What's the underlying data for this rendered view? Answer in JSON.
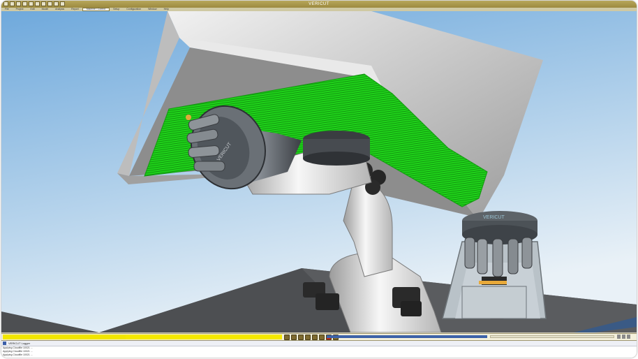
{
  "window": {
    "title": "VERICUT"
  },
  "menu": {
    "items": [
      "File",
      "Project",
      "Edit",
      "Model",
      "Analysis",
      "Report",
      "Machine / Control",
      "Setup",
      "Configuration",
      "Window",
      "Help"
    ],
    "active_index": 6
  },
  "toolbar": {
    "progress_fraction": 0.44
  },
  "logger": {
    "title": "VERICUT Logger",
    "rows": [
      "Applying Cloudfile 10021 ...",
      "Applying Cloudfile 10021 ...",
      "Applying Cloudfile 10021 ..."
    ]
  },
  "scene": {
    "colors": {
      "sky_top": "#6fa9dc",
      "sky_bottom": "#e9f1f7",
      "floor": "#4d4f52",
      "part_shell": "#d3d3d3",
      "toolpath": "#1fd21a",
      "robot": "#e6e6e6",
      "motor": "#2a2a2a",
      "fixture": "#b9c2c8",
      "tool_tip": "#e8a93a"
    },
    "labels": {
      "tool_changer_text": "VERICUT",
      "rack_text": "VERICUT"
    }
  }
}
